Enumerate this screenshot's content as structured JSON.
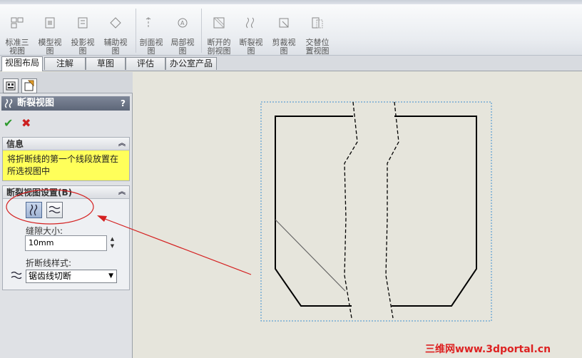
{
  "toolbar": {
    "items": [
      {
        "label": "标准三\n视图",
        "icon": "standard-3-view-icon"
      },
      {
        "label": "模型视\n图",
        "icon": "model-view-icon"
      },
      {
        "label": "投影视\n图",
        "icon": "projected-view-icon"
      },
      {
        "label": "辅助视\n图",
        "icon": "auxiliary-view-icon"
      },
      {
        "label": "剖面视\n图",
        "icon": "section-view-icon"
      },
      {
        "label": "局部视\n图",
        "icon": "detail-view-icon"
      },
      {
        "label": "断开的\n剖视图",
        "icon": "broken-out-section-icon"
      },
      {
        "label": "断裂视\n图",
        "icon": "break-view-icon"
      },
      {
        "label": "剪裁视\n图",
        "icon": "crop-view-icon"
      },
      {
        "label": "交替位\n置视图",
        "icon": "alternate-position-view-icon"
      }
    ]
  },
  "tabs": [
    "视图布局",
    "注解",
    "草图",
    "评估",
    "办公室产品"
  ],
  "active_tab": "视图布局",
  "panel": {
    "title": "断裂视图",
    "help": "?",
    "ok": "✔",
    "cancel": "✖",
    "info": {
      "header": "信息",
      "text": "将折断线的第一个线段放置在所选视图中"
    },
    "settings": {
      "header": "断裂视图设置(B)",
      "gap_label": "缝隙大小:",
      "gap_value": "10mm",
      "style_label": "折断线样式:",
      "style_value": "锯齿线切断"
    }
  },
  "watermark": "三维网www.3dportal.cn",
  "colors": {
    "annotation_red": "#d42020",
    "info_yellow": "#ffff5a",
    "selection_border": "#3d8fcf"
  }
}
